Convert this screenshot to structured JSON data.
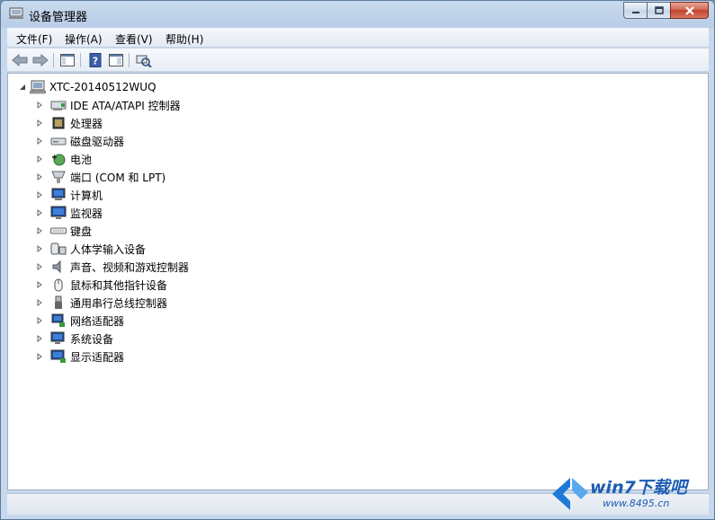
{
  "window": {
    "title": "设备管理器"
  },
  "menu": [
    {
      "label": "文件(F)"
    },
    {
      "label": "操作(A)"
    },
    {
      "label": "查看(V)"
    },
    {
      "label": "帮助(H)"
    }
  ],
  "tree": {
    "root": "XTC-20140512WUQ",
    "items": [
      {
        "label": "IDE ATA/ATAPI 控制器",
        "icon": "ide-controller-icon"
      },
      {
        "label": "处理器",
        "icon": "processor-icon"
      },
      {
        "label": "磁盘驱动器",
        "icon": "disk-drive-icon"
      },
      {
        "label": "电池",
        "icon": "battery-icon"
      },
      {
        "label": "端口 (COM 和 LPT)",
        "icon": "port-icon"
      },
      {
        "label": "计算机",
        "icon": "computer-icon"
      },
      {
        "label": "监视器",
        "icon": "monitor-icon"
      },
      {
        "label": "键盘",
        "icon": "keyboard-icon"
      },
      {
        "label": "人体学输入设备",
        "icon": "hid-icon"
      },
      {
        "label": "声音、视频和游戏控制器",
        "icon": "sound-icon"
      },
      {
        "label": "鼠标和其他指针设备",
        "icon": "mouse-icon"
      },
      {
        "label": "通用串行总线控制器",
        "icon": "usb-icon"
      },
      {
        "label": "网络适配器",
        "icon": "network-adapter-icon"
      },
      {
        "label": "系统设备",
        "icon": "system-device-icon"
      },
      {
        "label": "显示适配器",
        "icon": "display-adapter-icon"
      }
    ]
  },
  "watermark": {
    "brand": "win7下载吧",
    "url": "www.8495.cn"
  },
  "colors": {
    "accent": "#1d5db3",
    "close": "#c2432c"
  }
}
